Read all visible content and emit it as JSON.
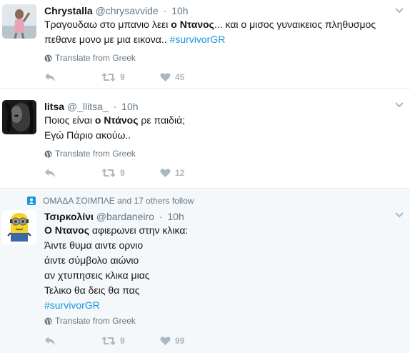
{
  "tweets": [
    {
      "name": "Chrystalla",
      "handle": "@chrysavvide",
      "separator": "·",
      "time": "10h",
      "lines": [
        [
          {
            "t": "Τραγουδαω στο μπανιο λεει ",
            "s": "text"
          },
          {
            "t": "ο Ντανος",
            "s": "mention"
          },
          {
            "t": "... και ο μισος γυναικειος πληθυσμος",
            "s": "text"
          }
        ],
        [
          {
            "t": "πεθανε μονο με μια εικονα.. ",
            "s": "text"
          },
          {
            "t": "#survivorGR",
            "s": "hashtag"
          }
        ]
      ],
      "translate": "Translate from Greek",
      "retweets": "9",
      "likes": "45"
    },
    {
      "name": "litsa",
      "handle": "@_llitsa_",
      "separator": "·",
      "time": "10h",
      "lines": [
        [
          {
            "t": "Ποιος είναι ",
            "s": "text"
          },
          {
            "t": "ο Ντάνος",
            "s": "mention"
          },
          {
            "t": " ρε παιδιά;",
            "s": "text"
          }
        ],
        [
          {
            "t": "Εγώ Πάριο ακούω..",
            "s": "text"
          }
        ]
      ],
      "translate": "Translate from Greek",
      "retweets": "9",
      "likes": "12"
    },
    {
      "social_context": "ΟΜΑΔΑ ΣΟΙΜΠΛΕ and 17 others follow",
      "name": "Τσιρκολίνι",
      "handle": "@bardaneiro",
      "separator": "·",
      "time": "10h",
      "lines": [
        [
          {
            "t": "Ο Ντανος",
            "s": "mention"
          },
          {
            "t": " αφιερωνει στην κλικα:",
            "s": "text"
          }
        ],
        [
          {
            "t": "Άιντε θυμα αιντε ορνιο",
            "s": "text"
          }
        ],
        [
          {
            "t": "άιντε σύμβολο αιώνιο",
            "s": "text"
          }
        ],
        [
          {
            "t": "αν χτυπησεις κλικα μιας",
            "s": "text"
          }
        ],
        [
          {
            "t": "Τελικο θα δεις θα πας",
            "s": "text"
          }
        ],
        [
          {
            "t": "#survivorGR",
            "s": "hashtag"
          }
        ]
      ],
      "translate": "Translate from Greek",
      "retweets": "9",
      "likes": "99"
    }
  ],
  "colors": {
    "link": "#1b95e0",
    "muted": "#657786",
    "action": "#aab8c2",
    "highlight_bg": "#f5f8fa",
    "divider": "#e6ecf0"
  },
  "icons": {
    "reply": "reply-icon",
    "retweet": "retweet-icon",
    "like": "heart-icon",
    "translate": "globe-icon",
    "more": "chevron-down-icon",
    "social_context": "person-icon"
  }
}
